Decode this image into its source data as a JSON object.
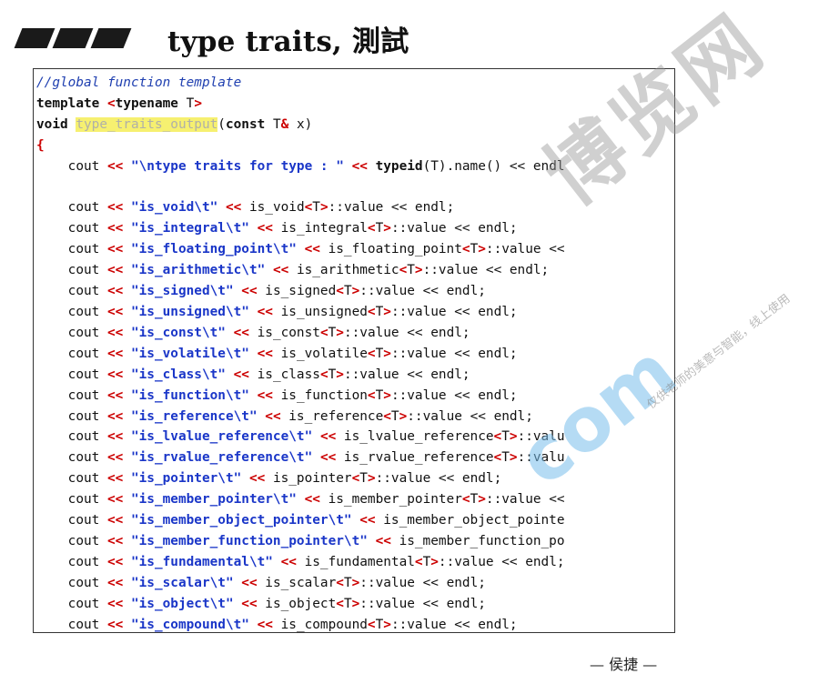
{
  "title": "type traits, 測試",
  "code_lines": {
    "l0": "//global function template",
    "l1_kw": "template",
    "l1_rest": "typename",
    "l1_t": "T",
    "l2_kw": "void",
    "l2_fn": "type_traits_output",
    "l2_const": "const",
    "l2_t": "T",
    "l2_x": " x)",
    "l3": "{",
    "l4_head": "    cout ",
    "l4_str": "\"\\ntype traits for type : \"",
    "l4_typeid": "typeid",
    "l4_tail": "(T).name() << endl"
  },
  "trait_lines": [
    {
      "str": "\"is_void\\t\"",
      "call": "is_void",
      "tail": "::value << endl;"
    },
    {
      "str": "\"is_integral\\t\"",
      "call": "is_integral",
      "tail": "::value << endl;"
    },
    {
      "str": "\"is_floating_point\\t\"",
      "call": "is_floating_point",
      "tail": "::value <<"
    },
    {
      "str": "\"is_arithmetic\\t\"",
      "call": "is_arithmetic",
      "tail": "::value << endl;"
    },
    {
      "str": "\"is_signed\\t\"",
      "call": "is_signed",
      "tail": "::value << endl;"
    },
    {
      "str": "\"is_unsigned\\t\"",
      "call": "is_unsigned",
      "tail": "::value << endl;"
    },
    {
      "str": "\"is_const\\t\"",
      "call": "is_const",
      "tail": "::value << endl;"
    },
    {
      "str": "\"is_volatile\\t\"",
      "call": "is_volatile",
      "tail": "::value << endl;"
    },
    {
      "str": "\"is_class\\t\"",
      "call": "is_class",
      "tail": "::value << endl;"
    },
    {
      "str": "\"is_function\\t\"",
      "call": "is_function",
      "tail": "::value << endl;"
    },
    {
      "str": "\"is_reference\\t\"",
      "call": "is_reference",
      "tail": "::value << endl;"
    },
    {
      "str": "\"is_lvalue_reference\\t\"",
      "call": "is_lvalue_reference",
      "tail": "::valu"
    },
    {
      "str": "\"is_rvalue_reference\\t\"",
      "call": "is_rvalue_reference",
      "tail": "::valu"
    },
    {
      "str": "\"is_pointer\\t\"",
      "call": "is_pointer",
      "tail": "::value << endl;"
    },
    {
      "str": "\"is_member_pointer\\t\"",
      "call": "is_member_pointer",
      "tail": "::value <<"
    },
    {
      "str": "\"is_member_object_pointer\\t\"",
      "call": "is_member_object_pointe",
      "tail": ""
    },
    {
      "str": "\"is_member_function_pointer\\t\"",
      "call": "is_member_function_po",
      "tail": ""
    },
    {
      "str": "\"is_fundamental\\t\"",
      "call": "is_fundamental",
      "tail": "::value << endl;"
    },
    {
      "str": "\"is_scalar\\t\"",
      "call": "is_scalar",
      "tail": "::value << endl;"
    },
    {
      "str": "\"is_object\\t\"",
      "call": "is_object",
      "tail": "::value << endl;"
    },
    {
      "str": "\"is_compound\\t\"",
      "call": "is_compound",
      "tail": "::value << endl;"
    }
  ],
  "watermark": {
    "main": "博览网",
    "blue": "com",
    "small": "仅供老师的美意与智能，线上使用"
  },
  "footer": "— 侯捷 —"
}
